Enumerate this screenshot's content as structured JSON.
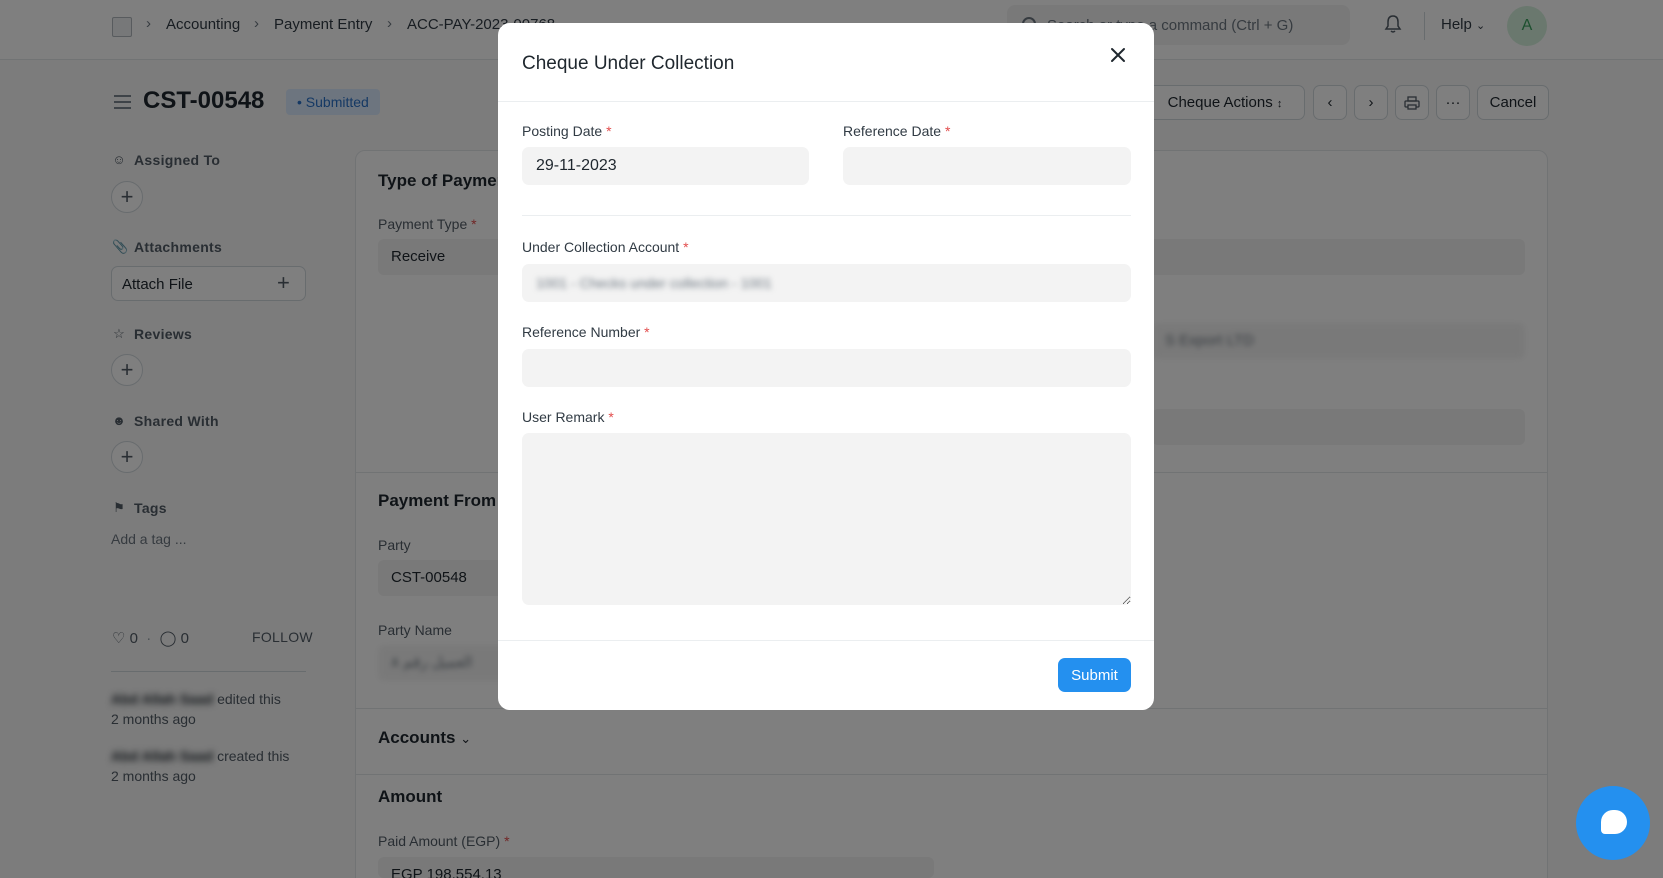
{
  "navbar": {
    "breadcrumbs": [
      "Accounting",
      "Payment Entry",
      "ACC-PAY-2023-00768"
    ],
    "search_placeholder": "Search or type a command (Ctrl + G)",
    "help_label": "Help",
    "avatar_initial": "A"
  },
  "header": {
    "title": "CST-00548",
    "status": "Submitted",
    "cheque_actions_label": "Cheque Actions",
    "cancel_label": "Cancel",
    "more_label": "···"
  },
  "sidebar": {
    "assigned_to": "Assigned To",
    "attachments": "Attachments",
    "attach_file": "Attach File",
    "reviews": "Reviews",
    "shared_with": "Shared With",
    "tags": "Tags",
    "add_tag": "Add a tag ...",
    "likes_count": "0",
    "comments_count": "0",
    "follow": "FOLLOW",
    "activity": [
      {
        "user": "Abd Allah Saad",
        "action": "edited this",
        "time": "2 months ago"
      },
      {
        "user": "Abd Allah Saad",
        "action": "created this",
        "time": "2 months ago"
      }
    ]
  },
  "form": {
    "section_type": "Type of Payment",
    "payment_type_label": "Payment Type",
    "payment_type_value": "Receive",
    "section_party": "Payment From / To",
    "party_label": "Party",
    "party_value": "CST-00548",
    "party_name_label": "Party Name",
    "party_name_value": "العميل رقم ٨",
    "right_blur_value": "S Export LTD",
    "section_accounts": "Accounts",
    "section_amount": "Amount",
    "paid_amount_label": "Paid Amount (EGP)",
    "paid_amount_value": "EGP 198,554.13"
  },
  "modal": {
    "title": "Cheque Under Collection",
    "posting_date_label": "Posting Date",
    "posting_date_value": "29-11-2023",
    "reference_date_label": "Reference Date",
    "reference_date_value": "",
    "under_collection_account_label": "Under Collection Account",
    "under_collection_account_value": "1001 - Checks under collection - 1001",
    "reference_number_label": "Reference Number",
    "reference_number_value": "",
    "user_remark_label": "User Remark",
    "user_remark_value": "",
    "required_marker": "*",
    "submit_label": "Submit"
  },
  "colors": {
    "primary": "#2490ef",
    "required": "#e24c4c",
    "status_bg": "#dbeafe",
    "status_text": "#2b72c9"
  }
}
